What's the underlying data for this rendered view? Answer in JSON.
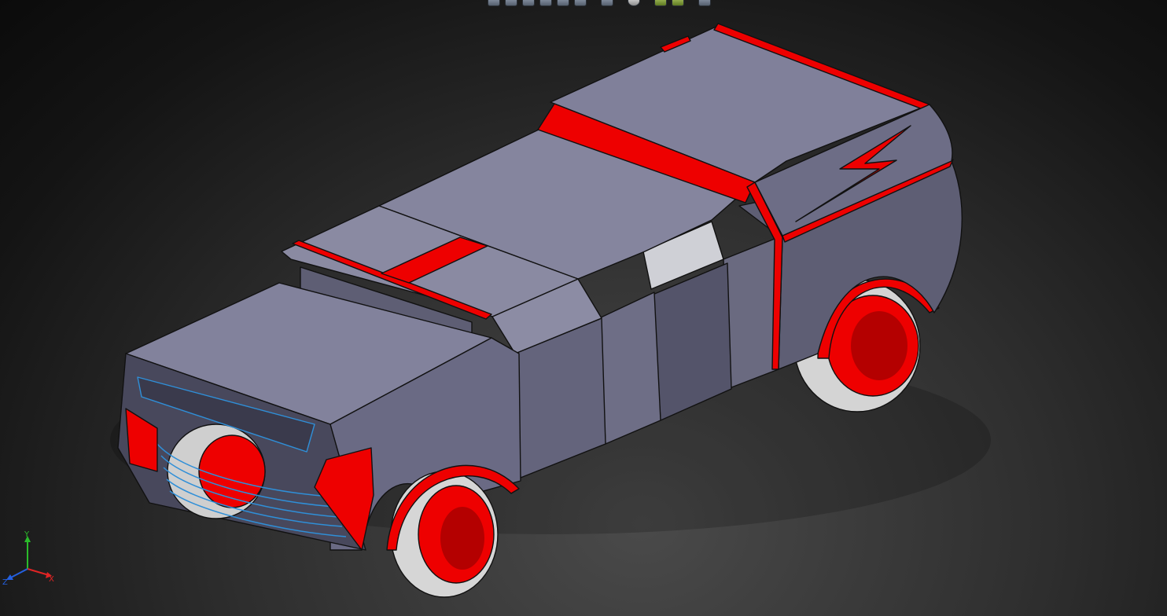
{
  "colors": {
    "body": "#7f7f96",
    "body_side": "#5f5f74",
    "accent_red": "#ee0000",
    "tire": "#d8d8d8",
    "edge": "#111111",
    "selection_blue": "#2f8fd8",
    "background_center": "#4a4a4a",
    "background_edge": "#0b0b0b"
  },
  "toolbar": {
    "icons": [
      "zoom-to-fit-icon",
      "zoom-area-icon",
      "previous-view-icon",
      "section-view-icon",
      "view-orientation-icon",
      "display-style-icon",
      "hide-show-icon",
      "appearance-icon",
      "scene-icon",
      "view-settings-icon",
      "display-manager-icon"
    ]
  },
  "triad": {
    "x_label": "X",
    "y_label": "Y",
    "z_label": "Z"
  },
  "model": {
    "view": "isometric",
    "display_style": "shaded-with-edges"
  }
}
